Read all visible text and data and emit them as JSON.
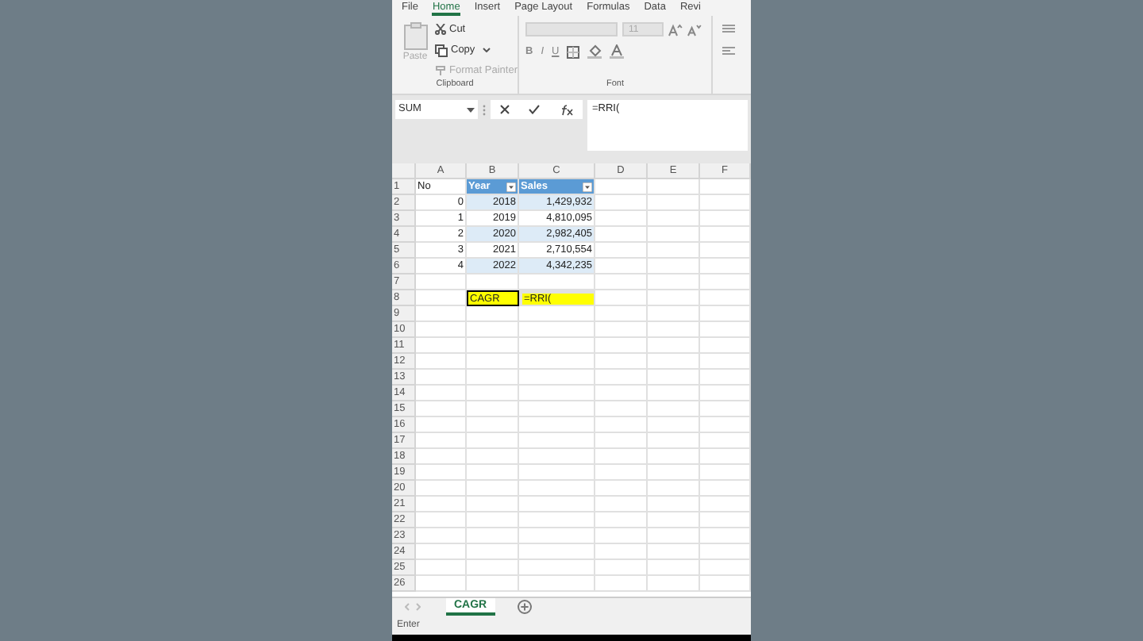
{
  "ribbon_tabs": [
    {
      "label": "File",
      "selected": false
    },
    {
      "label": "Home",
      "selected": true
    },
    {
      "label": "Insert",
      "selected": false
    },
    {
      "label": "Page Layout",
      "selected": false
    },
    {
      "label": "Formulas",
      "selected": false
    },
    {
      "label": "Data",
      "selected": false
    },
    {
      "label": "Revi",
      "selected": false
    }
  ],
  "clipboard": {
    "paste": "Paste",
    "cut": "Cut",
    "copy": "Copy",
    "format_painter": "Format Painter",
    "label": "Clipboard"
  },
  "font_group": {
    "size": "11",
    "bold": "B",
    "italic": "I",
    "underline": "U",
    "label": "Font"
  },
  "name_box": "SUM",
  "formula": "=RRI(",
  "columns": [
    "A",
    "B",
    "C",
    "D",
    "E",
    "F"
  ],
  "rows": [
    {
      "number": "1",
      "cells": [
        {
          "text": "No",
          "kind": "text"
        },
        {
          "text": "Year",
          "kind": "header"
        },
        {
          "text": "Sales",
          "kind": "header"
        }
      ]
    },
    {
      "number": "2",
      "cells": [
        {
          "text": "0",
          "kind": "number"
        },
        {
          "text": "2018",
          "kind": "band"
        },
        {
          "text": "1,429,932",
          "kind": "band"
        }
      ]
    },
    {
      "number": "3",
      "cells": [
        {
          "text": "1",
          "kind": "number"
        },
        {
          "text": "2019",
          "kind": "band_alt"
        },
        {
          "text": "4,810,095",
          "kind": "band_alt"
        }
      ]
    },
    {
      "number": "4",
      "cells": [
        {
          "text": "2",
          "kind": "number"
        },
        {
          "text": "2020",
          "kind": "band"
        },
        {
          "text": "2,982,405",
          "kind": "band"
        }
      ]
    },
    {
      "number": "5",
      "cells": [
        {
          "text": "3",
          "kind": "number"
        },
        {
          "text": "2021",
          "kind": "band_alt"
        },
        {
          "text": "2,710,554",
          "kind": "band_alt"
        }
      ]
    },
    {
      "number": "6",
      "cells": [
        {
          "text": "4",
          "kind": "number"
        },
        {
          "text": "2022",
          "kind": "band"
        },
        {
          "text": "4,342,235",
          "kind": "band"
        }
      ]
    },
    {
      "number": "7"
    },
    {
      "number": "8",
      "cells": [
        {
          "kind": "blank"
        },
        {
          "text": "CAGR",
          "kind": "yellow"
        },
        {
          "text": "=RRI(",
          "kind": "yellow_active"
        }
      ]
    },
    {
      "number": "9"
    },
    {
      "number": "10"
    },
    {
      "number": "11"
    },
    {
      "number": "12"
    },
    {
      "number": "13"
    },
    {
      "number": "14"
    },
    {
      "number": "15"
    },
    {
      "number": "16"
    },
    {
      "number": "17"
    },
    {
      "number": "18"
    },
    {
      "number": "19"
    },
    {
      "number": "20"
    },
    {
      "number": "21"
    },
    {
      "number": "22"
    },
    {
      "number": "23"
    },
    {
      "number": "24"
    },
    {
      "number": "25"
    },
    {
      "number": "26"
    }
  ],
  "sheet_tabs": [
    {
      "label": "CAGR",
      "selected": true
    }
  ],
  "status_bar": "Enter"
}
